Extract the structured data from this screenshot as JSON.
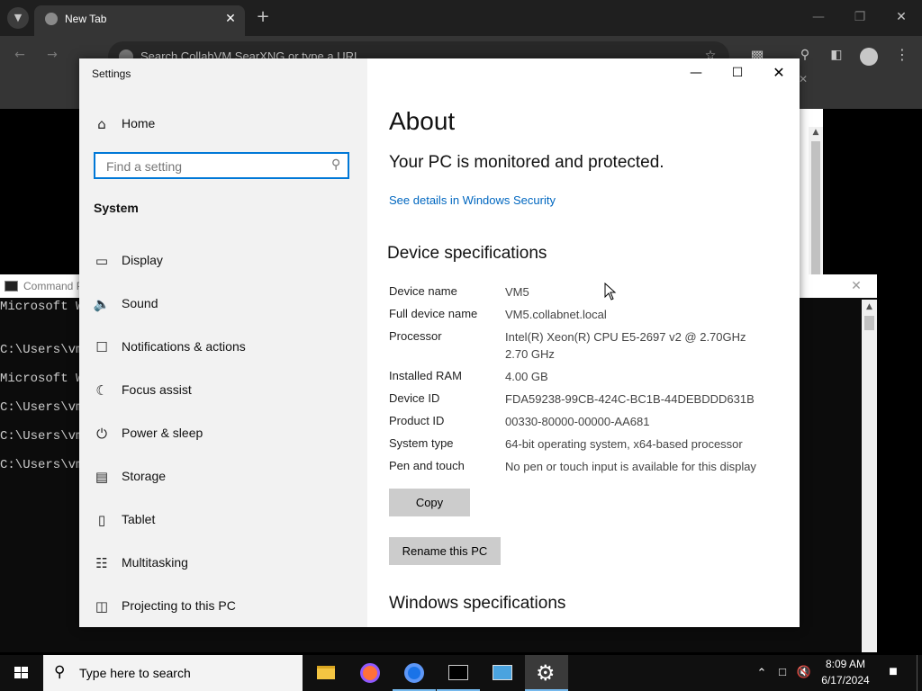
{
  "browser": {
    "tab_title": "New Tab",
    "address_placeholder": "Search CollabVM SearXNG or type a URL"
  },
  "cmd": {
    "title": "Command Prompt",
    "lines": [
      "Microsoft Windows",
      "C:\\Users\\vm5>",
      "Microsoft Windows",
      "C:\\Users\\vm5>",
      "C:\\Users\\vm5>",
      "C:\\Users\\vm5>"
    ]
  },
  "settings": {
    "window_title": "Settings",
    "nav": {
      "home": "Home",
      "search_placeholder": "Find a setting",
      "section": "System",
      "items": [
        {
          "label": "Display"
        },
        {
          "label": "Sound"
        },
        {
          "label": "Notifications & actions"
        },
        {
          "label": "Focus assist"
        },
        {
          "label": "Power & sleep"
        },
        {
          "label": "Storage"
        },
        {
          "label": "Tablet"
        },
        {
          "label": "Multitasking"
        },
        {
          "label": "Projecting to this PC"
        }
      ]
    },
    "about": {
      "title": "About",
      "protection_status": "Your PC is monitored and protected.",
      "security_link": "See details in Windows Security",
      "device_specs_heading": "Device specifications",
      "specs": [
        {
          "label": "Device name",
          "value": "VM5"
        },
        {
          "label": "Full device name",
          "value": "VM5.collabnet.local"
        },
        {
          "label": "Processor",
          "value": "Intel(R) Xeon(R) CPU E5-2697 v2 @ 2.70GHz 2.70 GHz"
        },
        {
          "label": "Installed RAM",
          "value": "4.00 GB"
        },
        {
          "label": "Device ID",
          "value": "FDA59238-99CB-424C-BC1B-44DEBDDD631B"
        },
        {
          "label": "Product ID",
          "value": "00330-80000-00000-AA681"
        },
        {
          "label": "System type",
          "value": "64-bit operating system, x64-based processor"
        },
        {
          "label": "Pen and touch",
          "value": "No pen or touch input is available for this display"
        }
      ],
      "copy_button": "Copy",
      "rename_button": "Rename this PC",
      "windows_specs_heading": "Windows specifications"
    }
  },
  "taskbar": {
    "search_placeholder": "Type here to search",
    "time": "8:09 AM",
    "date": "6/17/2024"
  },
  "colors": {
    "accent": "#0078d7",
    "link": "#0067c0"
  }
}
